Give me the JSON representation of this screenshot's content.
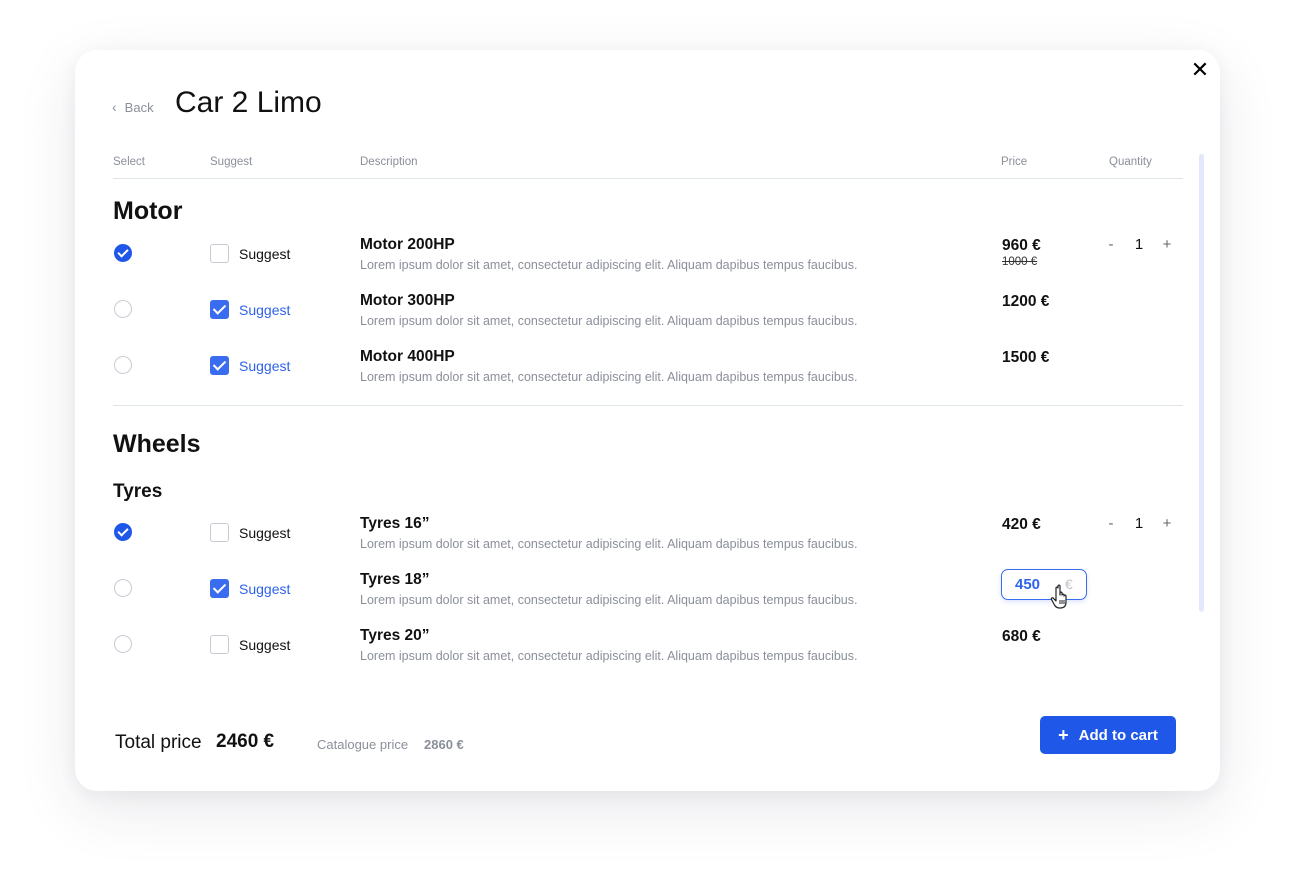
{
  "header": {
    "back_label": "Back",
    "title": "Car 2 Limo",
    "close_icon": "close-icon"
  },
  "columns": {
    "select": "Select",
    "suggest": "Suggest",
    "description": "Description",
    "price": "Price",
    "quantity": "Quantity"
  },
  "sections": {
    "motor": {
      "title": "Motor",
      "items": [
        {
          "selected": true,
          "suggested": false,
          "suggest_label": "Suggest",
          "name": "Motor 200HP",
          "desc": "Lorem ipsum dolor sit amet, consectetur adipiscing elit. Aliquam dapibus tempus faucibus.",
          "price": "960 €",
          "old_price": "1000 €",
          "qty": "1"
        },
        {
          "selected": false,
          "suggested": true,
          "suggest_label": "Suggest",
          "name": "Motor 300HP",
          "desc": "Lorem ipsum dolor sit amet, consectetur adipiscing elit. Aliquam dapibus tempus faucibus.",
          "price": "1200 €"
        },
        {
          "selected": false,
          "suggested": true,
          "suggest_label": "Suggest",
          "name": "Motor 400HP",
          "desc": "Lorem ipsum dolor sit amet, consectetur adipiscing elit. Aliquam dapibus tempus faucibus.",
          "price": "1500 €"
        }
      ]
    },
    "wheels": {
      "title": "Wheels",
      "subtitle": "Tyres",
      "items": [
        {
          "selected": true,
          "suggested": false,
          "suggest_label": "Suggest",
          "name": "Tyres 16”",
          "desc": "Lorem ipsum dolor sit amet, consectetur adipiscing elit. Aliquam dapibus tempus faucibus.",
          "price": "420 €",
          "qty": "1"
        },
        {
          "selected": false,
          "suggested": true,
          "suggest_label": "Suggest",
          "name": "Tyres 18”",
          "desc": "Lorem ipsum dolor sit amet, consectetur adipiscing elit. Aliquam dapibus tempus faucibus.",
          "price_input_value": "450",
          "price_input_unit": "€"
        },
        {
          "selected": false,
          "suggested": false,
          "suggest_label": "Suggest",
          "name": "Tyres 20”",
          "desc": "Lorem ipsum dolor sit amet, consectetur adipiscing elit. Aliquam dapibus tempus faucibus.",
          "price": "680 €"
        }
      ]
    }
  },
  "qty_controls": {
    "minus": "-",
    "plus": "+"
  },
  "footer": {
    "total_label": "Total price",
    "total_value": "2460 €",
    "catalogue_label": "Catalogue price",
    "catalogue_value": "2860 €",
    "add_icon": "+",
    "add_label": "Add to cart"
  },
  "colors": {
    "accent": "#1f57e8",
    "accent_light": "#3a6cef",
    "muted_text": "#8a8f99",
    "divider": "#dfe6ea"
  }
}
